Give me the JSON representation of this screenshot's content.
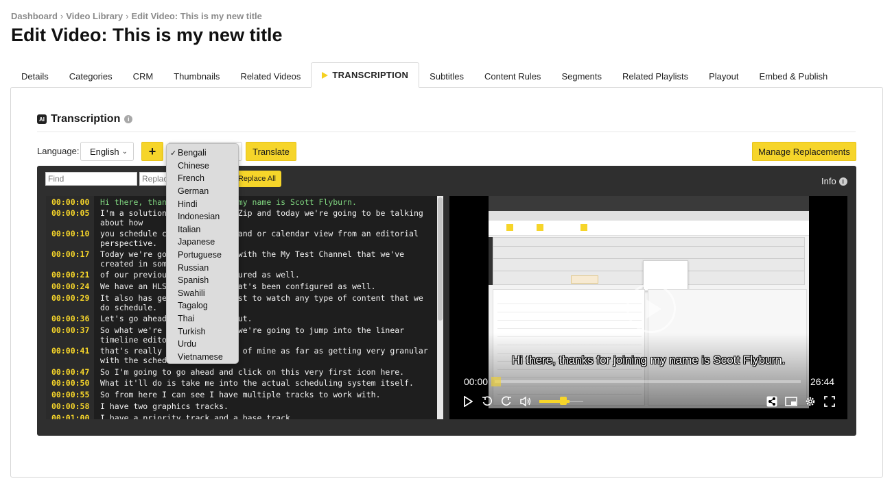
{
  "breadcrumb": [
    "Dashboard",
    "Video Library",
    "Edit Video: This is my new title"
  ],
  "page_title": "Edit Video: This is my new title",
  "tabs": [
    {
      "label": "Details"
    },
    {
      "label": "Categories"
    },
    {
      "label": "CRM"
    },
    {
      "label": "Thumbnails"
    },
    {
      "label": "Related Videos"
    },
    {
      "label": "TRANSCRIPTION",
      "active": true
    },
    {
      "label": "Subtitles"
    },
    {
      "label": "Content Rules"
    },
    {
      "label": "Segments"
    },
    {
      "label": "Related Playlists"
    },
    {
      "label": "Playout"
    },
    {
      "label": "Embed & Publish"
    }
  ],
  "transcription": {
    "heading": "Transcription",
    "ai_icon": "AI",
    "info_icon": "i",
    "language_label": "Language:",
    "language_value": "English",
    "plus_label": "+",
    "translate_label": "Translate",
    "manage_label": "Manage Replacements"
  },
  "target_languages": {
    "selected": "Bengali",
    "options": [
      "Bengali",
      "Chinese",
      "French",
      "German",
      "Hindi",
      "Indonesian",
      "Italian",
      "Japanese",
      "Portuguese",
      "Russian",
      "Spanish",
      "Swahili",
      "Tagalog",
      "Thai",
      "Turkish",
      "Urdu",
      "Vietnamese"
    ]
  },
  "editor": {
    "find_placeholder": "Find",
    "replace_placeholder": "Replace",
    "replace_all_label": "Replace All",
    "info_label": "Info"
  },
  "transcript": [
    {
      "time": "00:00:00",
      "text": "Hi there, thanks for joining my name is Scott Flyburn.",
      "current": true
    },
    {
      "time": "00:00:05",
      "text": "I'm a solution engineer with Zip and today we're going to be talking about how"
    },
    {
      "time": "00:00:10",
      "text": "you schedule content in line and or calendar view from an editorial perspective."
    },
    {
      "time": "00:00:17",
      "text": "Today we're going to working with the My Test Channel that we've created in some"
    },
    {
      "time": "00:00:21",
      "text": "of our previous videos configured as well."
    },
    {
      "time": "00:00:24",
      "text": "We have an HLS output type that's been configured as well."
    },
    {
      "time": "00:00:29",
      "text": "It also has generic rules first to watch any type of content that we do schedule."
    },
    {
      "time": "00:00:36",
      "text": "Let's go ahead and check it out."
    },
    {
      "time": "00:00:37",
      "text": "So what we're going to do is we're going to jump into the linear timeline editor."
    },
    {
      "time": "00:00:41",
      "text": "that's really a favorite site of mine as far as getting very granular with the schedule."
    },
    {
      "time": "00:00:47",
      "text": "So I'm going to go ahead and click on this very first icon here."
    },
    {
      "time": "00:00:50",
      "text": "What it'll do is take me into the actual scheduling system itself."
    },
    {
      "time": "00:00:55",
      "text": "So from here I can see I have multiple tracks to work with."
    },
    {
      "time": "00:00:58",
      "text": "I have two graphics tracks."
    },
    {
      "time": "00:01:00",
      "text": "I have a priority track and a base track."
    }
  ],
  "video": {
    "subtitle": "Hi there, thanks for joining my name is Scott Flyburn.",
    "current_time": "00:00",
    "duration": "26:44",
    "progress": 0.0,
    "volume": 0.75
  },
  "colors": {
    "accent": "#f6d52a",
    "editor_bg": "#2f2f2f",
    "timestamp": "#f6d52a",
    "current_line": "#7fd47f"
  }
}
